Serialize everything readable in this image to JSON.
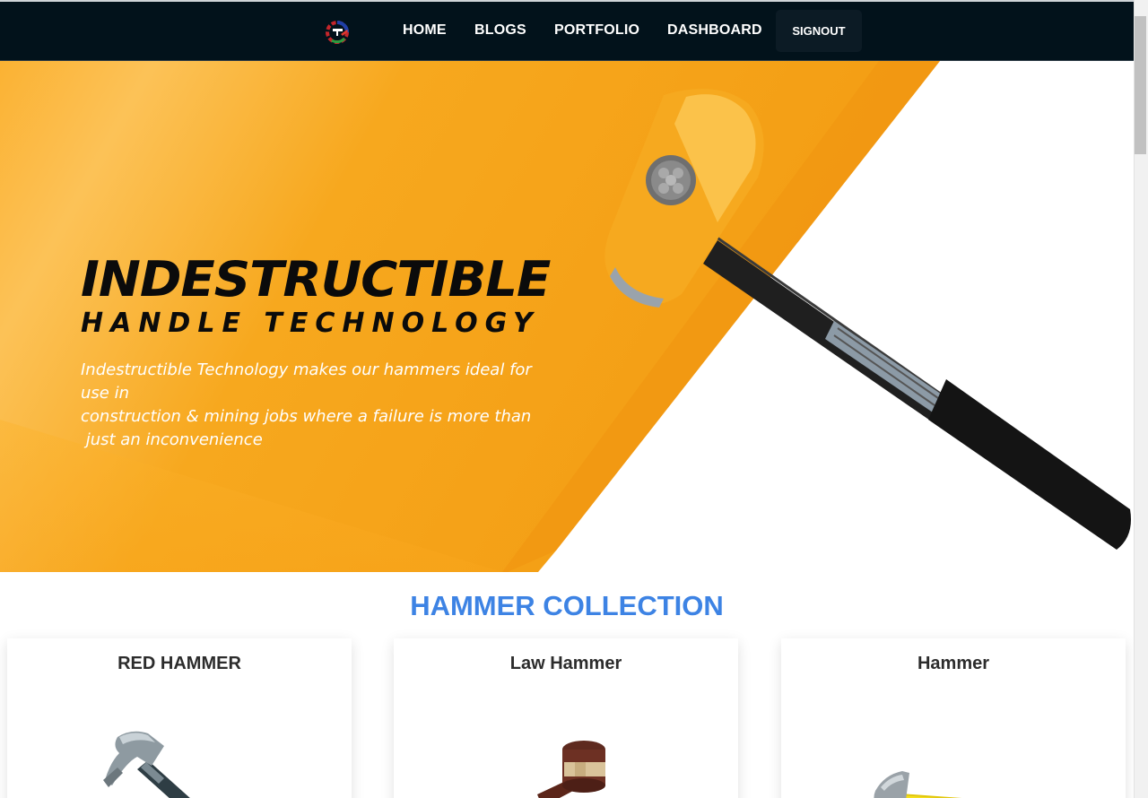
{
  "nav": {
    "links": [
      "HOME",
      "BLOGS",
      "PORTFOLIO",
      "DASHBOARD"
    ],
    "signout_label": "SIGNOUT",
    "logo_icon": "gear-hammer-logo-icon"
  },
  "hero": {
    "title": "INDESTRUCTIBLE",
    "subtitle": "HANDLE TECHNOLOGY",
    "description_lines": [
      "Indestructible Technology makes our hammers ideal for use in",
      "construction & mining jobs where a failure is more than",
      " just an inconvenience"
    ],
    "image_icon": "sledgehammer-icon"
  },
  "collection": {
    "title": "HAMMER COLLECTION",
    "products": [
      {
        "name": "RED HAMMER",
        "icon": "claw-hammer-icon"
      },
      {
        "name": "Law Hammer",
        "icon": "gavel-icon"
      },
      {
        "name": "Hammer",
        "icon": "yellow-hammer-icon"
      }
    ]
  },
  "colors": {
    "navbar": "#02121b",
    "accent_blue": "#3d83e4",
    "hero_orange": "#f8a822"
  }
}
